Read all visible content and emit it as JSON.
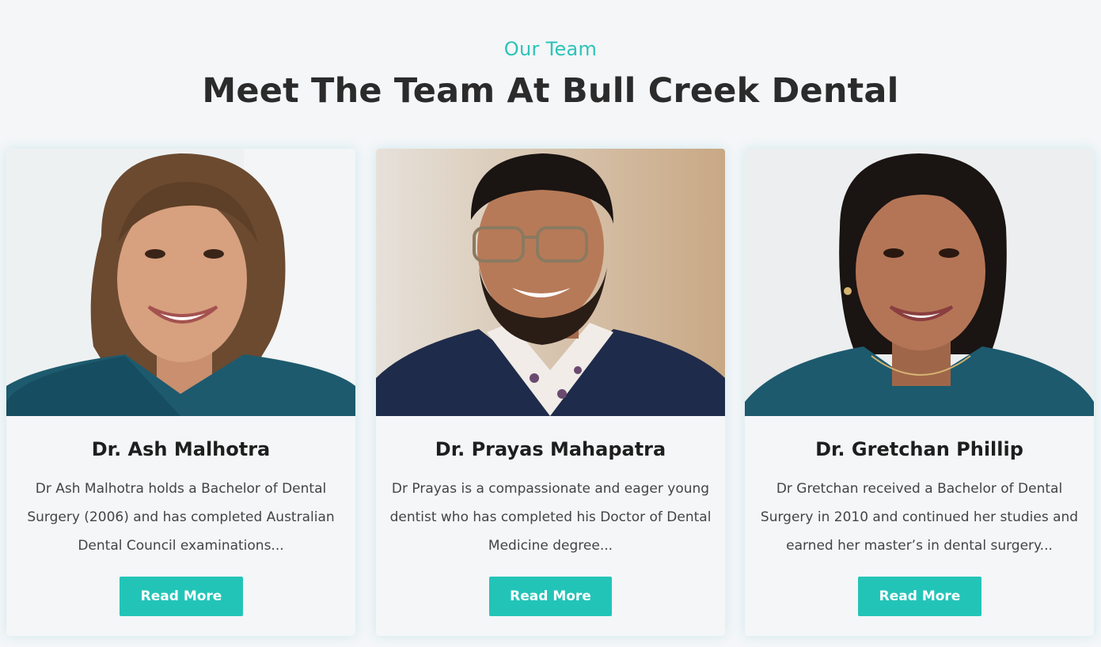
{
  "section": {
    "eyebrow": "Our Team",
    "title": "Meet The Team At Bull Creek Dental"
  },
  "team": [
    {
      "name": "Dr. Ash Malhotra",
      "description": "Dr Ash Malhotra holds a Bachelor of Dental Surgery (2006) and has completed Australian Dental Council examinations...",
      "button_label": "Read More"
    },
    {
      "name": "Dr. Prayas Mahapatra",
      "description": "Dr Prayas is a compassionate and eager young dentist who has completed his Doctor of Dental Medicine degree...",
      "button_label": "Read More"
    },
    {
      "name": "Dr. Gretchan Phillip",
      "description": "Dr Gretchan received a Bachelor of Dental Surgery in 2010 and continued her studies and earned her master’s in dental surgery...",
      "button_label": "Read More"
    }
  ],
  "colors": {
    "accent": "#23c4b8",
    "eyebrow": "#2cc4b8",
    "heading": "#2b2b2b",
    "background": "#f4f6f8"
  }
}
